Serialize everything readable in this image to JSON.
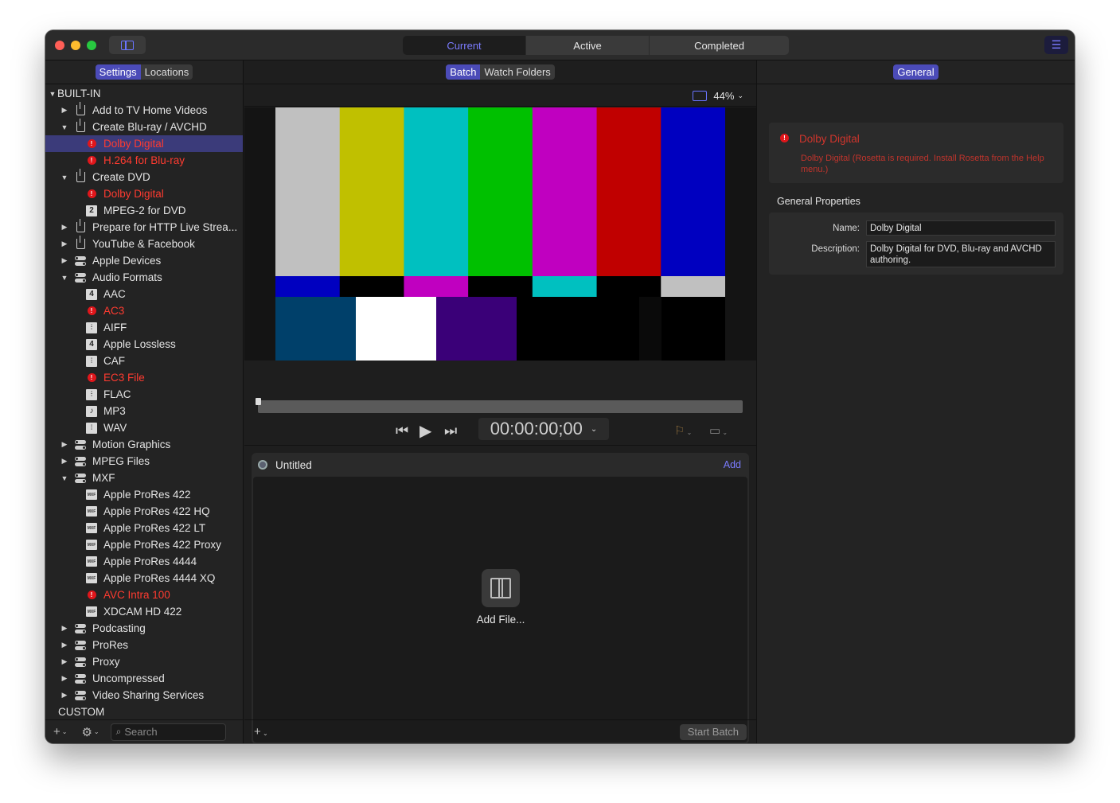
{
  "titlebar": {
    "tabs": [
      "Current",
      "Active",
      "Completed"
    ],
    "active_tab": "Current"
  },
  "left": {
    "tabs": [
      "Settings",
      "Locations"
    ],
    "active_tab": "Settings",
    "tree": [
      {
        "label": "BUILT-IN",
        "level": 0,
        "disclosure": "open",
        "icon": "none"
      },
      {
        "label": "Add to TV Home Videos",
        "level": 1,
        "disclosure": "closed",
        "icon": "share-icon"
      },
      {
        "label": "Create Blu-ray / AVCHD",
        "level": 1,
        "disclosure": "open",
        "icon": "share-icon"
      },
      {
        "label": "Dolby Digital",
        "level": 2,
        "icon": "error-icon",
        "error": true,
        "selected": true
      },
      {
        "label": "H.264 for Blu-ray",
        "level": 2,
        "icon": "error-icon",
        "error": true
      },
      {
        "label": "Create DVD",
        "level": 1,
        "disclosure": "open",
        "icon": "share-icon"
      },
      {
        "label": "Dolby Digital",
        "level": 2,
        "icon": "error-icon",
        "error": true
      },
      {
        "label": "MPEG-2 for DVD",
        "level": 2,
        "icon": "box-icon",
        "badge": "2"
      },
      {
        "label": "Prepare for HTTP Live Strea...",
        "level": 1,
        "disclosure": "closed",
        "icon": "share-icon"
      },
      {
        "label": "YouTube & Facebook",
        "level": 1,
        "disclosure": "closed",
        "icon": "share-icon"
      },
      {
        "label": "Apple Devices",
        "level": 1,
        "disclosure": "closed",
        "icon": "toggle-icon"
      },
      {
        "label": "Audio Formats",
        "level": 1,
        "disclosure": "open",
        "icon": "toggle-icon"
      },
      {
        "label": "AAC",
        "level": 2,
        "icon": "box-icon",
        "badge": "4"
      },
      {
        "label": "AC3",
        "level": 2,
        "icon": "error-icon",
        "error": true
      },
      {
        "label": "AIFF",
        "level": 2,
        "icon": "waveform-icon"
      },
      {
        "label": "Apple Lossless",
        "level": 2,
        "icon": "box-icon",
        "badge": "4"
      },
      {
        "label": "CAF",
        "level": 2,
        "icon": "waveform-icon"
      },
      {
        "label": "EC3 File",
        "level": 2,
        "icon": "error-icon",
        "error": true
      },
      {
        "label": "FLAC",
        "level": 2,
        "icon": "waveform-icon"
      },
      {
        "label": "MP3",
        "level": 2,
        "icon": "music-note-icon"
      },
      {
        "label": "WAV",
        "level": 2,
        "icon": "waveform-icon"
      },
      {
        "label": "Motion Graphics",
        "level": 1,
        "disclosure": "closed",
        "icon": "toggle-icon"
      },
      {
        "label": "MPEG Files",
        "level": 1,
        "disclosure": "closed",
        "icon": "toggle-icon"
      },
      {
        "label": "MXF",
        "level": 1,
        "disclosure": "open",
        "icon": "toggle-icon"
      },
      {
        "label": "Apple ProRes 422",
        "level": 2,
        "icon": "mxf-icon"
      },
      {
        "label": "Apple ProRes 422 HQ",
        "level": 2,
        "icon": "mxf-icon"
      },
      {
        "label": "Apple ProRes 422 LT",
        "level": 2,
        "icon": "mxf-icon"
      },
      {
        "label": "Apple ProRes 422 Proxy",
        "level": 2,
        "icon": "mxf-icon"
      },
      {
        "label": "Apple ProRes 4444",
        "level": 2,
        "icon": "mxf-icon"
      },
      {
        "label": "Apple ProRes 4444 XQ",
        "level": 2,
        "icon": "mxf-icon"
      },
      {
        "label": "AVC Intra 100",
        "level": 2,
        "icon": "error-icon",
        "error": true
      },
      {
        "label": "XDCAM HD 422",
        "level": 2,
        "icon": "mxf-icon"
      },
      {
        "label": "Podcasting",
        "level": 1,
        "disclosure": "closed",
        "icon": "toggle-icon"
      },
      {
        "label": "ProRes",
        "level": 1,
        "disclosure": "closed",
        "icon": "toggle-icon"
      },
      {
        "label": "Proxy",
        "level": 1,
        "disclosure": "closed",
        "icon": "toggle-icon"
      },
      {
        "label": "Uncompressed",
        "level": 1,
        "disclosure": "closed",
        "icon": "toggle-icon"
      },
      {
        "label": "Video Sharing Services",
        "level": 1,
        "disclosure": "closed",
        "icon": "toggle-icon"
      },
      {
        "label": "CUSTOM",
        "level": 0,
        "disclosure": "none",
        "icon": "none"
      }
    ],
    "search_placeholder": "Search",
    "badge_mxf": "MXF"
  },
  "center": {
    "tabs": [
      "Batch",
      "Watch Folders"
    ],
    "active_tab": "Batch",
    "zoom": "44%",
    "timecode": "00:00:00;00",
    "batch_title": "Untitled",
    "add_link": "Add",
    "add_file_label": "Add File...",
    "start_batch": "Start Batch",
    "color_bars_top": [
      "#c0c0c0",
      "#c0c000",
      "#00c0c0",
      "#00c000",
      "#c000c0",
      "#c00000",
      "#0000c0"
    ],
    "color_bars_mid": [
      "#0000c0",
      "#000000",
      "#c000c0",
      "#000000",
      "#00c0c0",
      "#000000",
      "#c0c0c0"
    ],
    "color_bars_bottom": [
      "#00406a",
      "#ffffff",
      "#3a0078",
      "#000000",
      "#000000",
      "#0a0a0a",
      "#000000"
    ]
  },
  "inspector": {
    "tab": "General",
    "error_title": "Dolby Digital",
    "error_message": "Dolby Digital (Rosetta is required. Install Rosetta from the Help menu.)",
    "section_title": "General Properties",
    "name_label": "Name:",
    "name_value": "Dolby Digital",
    "description_label": "Description:",
    "description_value": "Dolby Digital for DVD, Blu-ray and AVCHD authoring."
  }
}
